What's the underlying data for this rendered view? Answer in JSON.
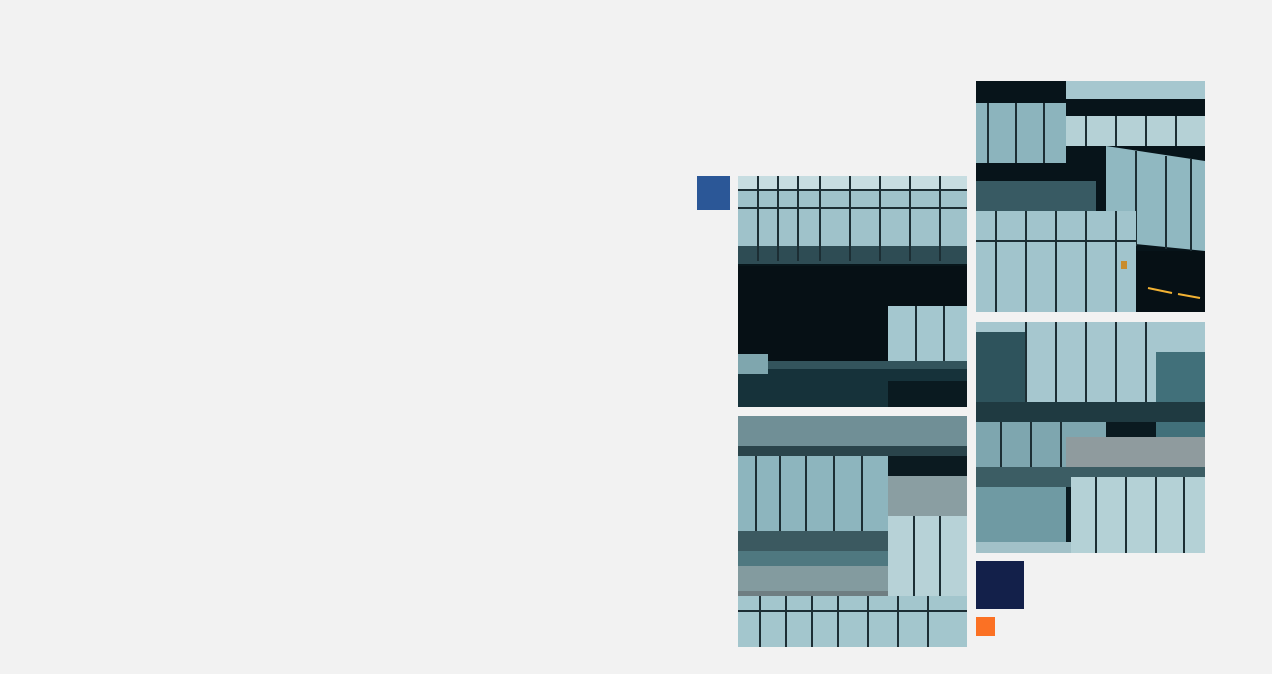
{
  "slide": {
    "background": "#f2f2f2",
    "accents": {
      "blue": "#2b5797",
      "navy": "#13204a",
      "orange": "#fb7124"
    },
    "photo": {
      "subject_icon": "glass-building-photo",
      "glass_light": "#a9c9d0",
      "glass_mid": "#5d8a94",
      "glass_dark": "#0b1a1f",
      "frame": "#1c2e34"
    }
  }
}
